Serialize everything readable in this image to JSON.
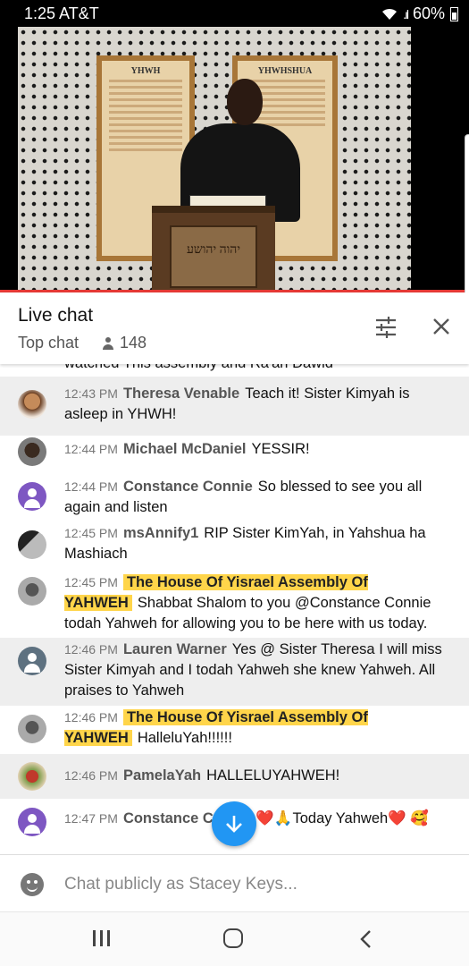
{
  "status_bar": {
    "time": "1:25 AT&T",
    "battery": "60%"
  },
  "video": {
    "sign_left_title": "YHWH",
    "sign_right_title": "YHWHSHUA",
    "podium_text": "יהוה יהושע"
  },
  "chat_header": {
    "title": "Live chat",
    "mode": "Top chat",
    "viewer_count": "148"
  },
  "messages": [
    {
      "time": "",
      "author": "",
      "text": "watched This assembly and Ra'an Dawid"
    },
    {
      "time": "12:43 PM",
      "author": "Theresa Venable",
      "text": "Teach it! Sister Kimyah is asleep in YHWH!"
    },
    {
      "time": "12:44 PM",
      "author": "Michael McDaniel",
      "text": "YESSIR!"
    },
    {
      "time": "12:44 PM",
      "author": "Constance Connie",
      "text": "So blessed to see you all again and listen"
    },
    {
      "time": "12:45 PM",
      "author": "msAnnify1",
      "text": "RIP Sister KimYah, in Yahshua ha Mashiach"
    },
    {
      "time": "12:45 PM",
      "author": "The House Of Yisrael Assembly Of YAHWEH",
      "text": "Shabbat Shalom to you @Constance Connie todah Yahweh for allowing you to be here with us today."
    },
    {
      "time": "12:46 PM",
      "author": "Lauren Warner",
      "text": "Yes @ Sister Theresa I will miss Sister Kimyah and I todah Yahweh she knew Yahweh. All praises to Yahweh"
    },
    {
      "time": "12:46 PM",
      "author": "The House Of Yisrael Assembly Of YAHWEH",
      "text": "HalleluYah!!!!!!"
    },
    {
      "time": "12:46 PM",
      "author": "PamelaYah",
      "text": "HALLELUYAHWEH!"
    },
    {
      "time": "12:47 PM",
      "author": "Constance Co",
      "text": "Yes ❤️🙏Today Yahweh❤️ 🥰"
    }
  ],
  "input": {
    "placeholder": "Chat publicly as Stacey Keys..."
  },
  "colors": {
    "accent": "#2196f3",
    "moderator_highlight": "#ffd54a",
    "progress": "#e53935"
  },
  "icons": [
    "wifi-icon",
    "signal-icon",
    "battery-icon",
    "person-icon",
    "filter-icon",
    "close-icon",
    "arrow-down-icon",
    "smiley-icon",
    "recents-icon",
    "home-icon",
    "back-icon"
  ]
}
